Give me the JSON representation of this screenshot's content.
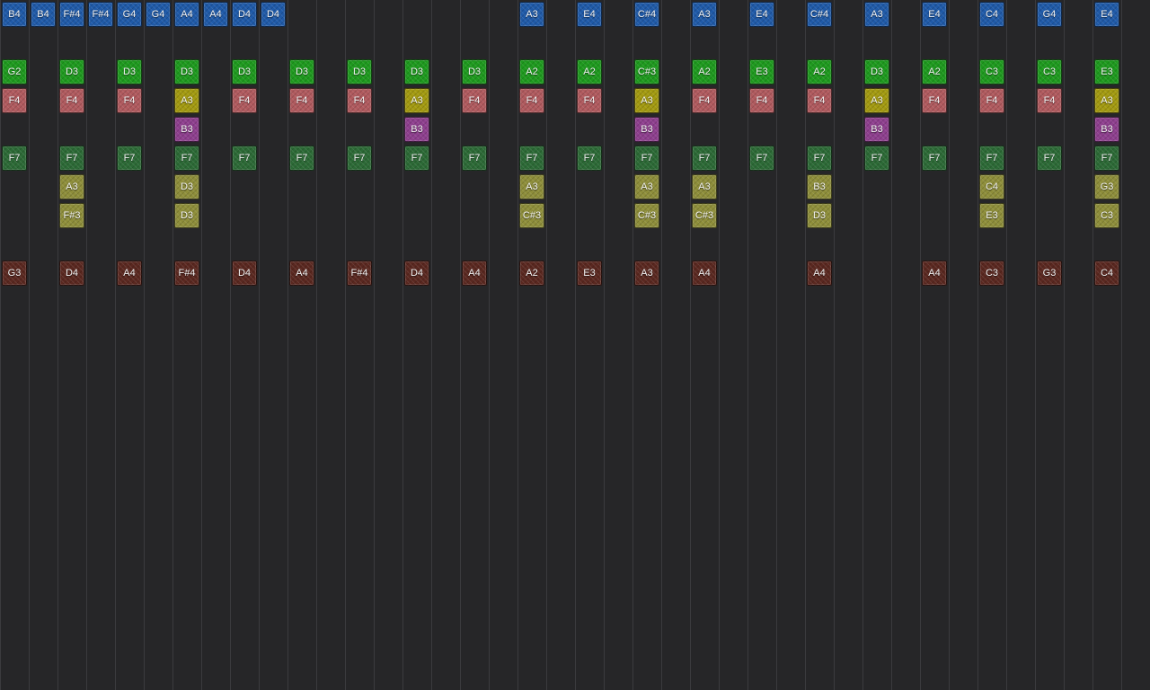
{
  "tracks": [
    {
      "name": "melody",
      "color": "#1f5aa8",
      "notes": [
        {
          "col": 0,
          "label": "B4"
        },
        {
          "col": 1,
          "label": "B4"
        },
        {
          "col": 2,
          "label": "F#4"
        },
        {
          "col": 3,
          "label": "F#4"
        },
        {
          "col": 4,
          "label": "G4"
        },
        {
          "col": 5,
          "label": "G4"
        },
        {
          "col": 6,
          "label": "A4"
        },
        {
          "col": 7,
          "label": "A4"
        },
        {
          "col": 8,
          "label": "D4"
        },
        {
          "col": 9,
          "label": "D4"
        },
        {
          "col": 18,
          "label": "A3"
        },
        {
          "col": 20,
          "label": "E4"
        },
        {
          "col": 22,
          "label": "C#4"
        },
        {
          "col": 24,
          "label": "A3"
        },
        {
          "col": 26,
          "label": "E4"
        },
        {
          "col": 28,
          "label": "C#4"
        },
        {
          "col": 30,
          "label": "A3"
        },
        {
          "col": 32,
          "label": "E4"
        },
        {
          "col": 34,
          "label": "C4"
        },
        {
          "col": 36,
          "label": "G4"
        },
        {
          "col": 38,
          "label": "E4"
        }
      ]
    },
    {
      "name": "bass-green",
      "color": "#1e9a1e",
      "notes": [
        {
          "col": 0,
          "label": "G2"
        },
        {
          "col": 2,
          "label": "D3"
        },
        {
          "col": 4,
          "label": "D3"
        },
        {
          "col": 6,
          "label": "D3"
        },
        {
          "col": 8,
          "label": "D3"
        },
        {
          "col": 10,
          "label": "D3"
        },
        {
          "col": 12,
          "label": "D3"
        },
        {
          "col": 14,
          "label": "D3"
        },
        {
          "col": 16,
          "label": "D3"
        },
        {
          "col": 18,
          "label": "A2"
        },
        {
          "col": 20,
          "label": "A2"
        },
        {
          "col": 22,
          "label": "C#3"
        },
        {
          "col": 24,
          "label": "A2"
        },
        {
          "col": 26,
          "label": "E3"
        },
        {
          "col": 28,
          "label": "A2"
        },
        {
          "col": 30,
          "label": "D3"
        },
        {
          "col": 32,
          "label": "A2"
        },
        {
          "col": 34,
          "label": "C3"
        },
        {
          "col": 36,
          "label": "C3"
        },
        {
          "col": 38,
          "label": "E3"
        }
      ]
    },
    {
      "name": "pink",
      "color": "#b05a5e",
      "notes": [
        {
          "col": 0,
          "label": "F4"
        },
        {
          "col": 2,
          "label": "F4"
        },
        {
          "col": 4,
          "label": "F4"
        },
        {
          "col": 8,
          "label": "F4"
        },
        {
          "col": 10,
          "label": "F4"
        },
        {
          "col": 12,
          "label": "F4"
        },
        {
          "col": 16,
          "label": "F4"
        },
        {
          "col": 18,
          "label": "F4"
        },
        {
          "col": 20,
          "label": "F4"
        },
        {
          "col": 24,
          "label": "F4"
        },
        {
          "col": 26,
          "label": "F4"
        },
        {
          "col": 28,
          "label": "F4"
        },
        {
          "col": 32,
          "label": "F4"
        },
        {
          "col": 34,
          "label": "F4"
        },
        {
          "col": 36,
          "label": "F4"
        }
      ]
    },
    {
      "name": "yellow",
      "color": "#a39a10",
      "notes": [
        {
          "col": 6,
          "label": "A3"
        },
        {
          "col": 14,
          "label": "A3"
        },
        {
          "col": 22,
          "label": "A3"
        },
        {
          "col": 30,
          "label": "A3"
        },
        {
          "col": 38,
          "label": "A3"
        }
      ]
    },
    {
      "name": "purple",
      "color": "#8e3f8e",
      "notes": [
        {
          "col": 6,
          "label": "B3"
        },
        {
          "col": 14,
          "label": "B3"
        },
        {
          "col": 22,
          "label": "B3"
        },
        {
          "col": 30,
          "label": "B3"
        },
        {
          "col": 38,
          "label": "B3"
        }
      ]
    },
    {
      "name": "dark-green",
      "color": "#2c6a36",
      "notes": [
        {
          "col": 0,
          "label": "F7"
        },
        {
          "col": 2,
          "label": "F7"
        },
        {
          "col": 4,
          "label": "F7"
        },
        {
          "col": 6,
          "label": "F7"
        },
        {
          "col": 8,
          "label": "F7"
        },
        {
          "col": 10,
          "label": "F7"
        },
        {
          "col": 12,
          "label": "F7"
        },
        {
          "col": 14,
          "label": "F7"
        },
        {
          "col": 16,
          "label": "F7"
        },
        {
          "col": 18,
          "label": "F7"
        },
        {
          "col": 20,
          "label": "F7"
        },
        {
          "col": 22,
          "label": "F7"
        },
        {
          "col": 24,
          "label": "F7"
        },
        {
          "col": 26,
          "label": "F7"
        },
        {
          "col": 28,
          "label": "F7"
        },
        {
          "col": 30,
          "label": "F7"
        },
        {
          "col": 32,
          "label": "F7"
        },
        {
          "col": 34,
          "label": "F7"
        },
        {
          "col": 36,
          "label": "F7"
        },
        {
          "col": 38,
          "label": "F7"
        }
      ]
    },
    {
      "name": "olive-1",
      "color": "#8e8e3a",
      "notes": [
        {
          "col": 2,
          "label": "A3"
        },
        {
          "col": 6,
          "label": "D3"
        },
        {
          "col": 18,
          "label": "A3"
        },
        {
          "col": 22,
          "label": "A3"
        },
        {
          "col": 24,
          "label": "A3"
        },
        {
          "col": 28,
          "label": "B3"
        },
        {
          "col": 34,
          "label": "C4"
        },
        {
          "col": 38,
          "label": "G3"
        }
      ]
    },
    {
      "name": "olive-2",
      "color": "#8e8e3a",
      "notes": [
        {
          "col": 2,
          "label": "F#3"
        },
        {
          "col": 6,
          "label": "D3"
        },
        {
          "col": 18,
          "label": "C#3"
        },
        {
          "col": 22,
          "label": "C#3"
        },
        {
          "col": 24,
          "label": "C#3"
        },
        {
          "col": 28,
          "label": "D3"
        },
        {
          "col": 34,
          "label": "E3"
        },
        {
          "col": 38,
          "label": "C3"
        }
      ]
    },
    {
      "name": "brown",
      "color": "#5a2820",
      "notes": [
        {
          "col": 0,
          "label": "G3"
        },
        {
          "col": 2,
          "label": "D4"
        },
        {
          "col": 4,
          "label": "A4"
        },
        {
          "col": 6,
          "label": "F#4"
        },
        {
          "col": 8,
          "label": "D4"
        },
        {
          "col": 10,
          "label": "A4"
        },
        {
          "col": 12,
          "label": "F#4"
        },
        {
          "col": 14,
          "label": "D4"
        },
        {
          "col": 16,
          "label": "A4"
        },
        {
          "col": 18,
          "label": "A2"
        },
        {
          "col": 20,
          "label": "E3"
        },
        {
          "col": 22,
          "label": "A3"
        },
        {
          "col": 24,
          "label": "A4"
        },
        {
          "col": 28,
          "label": "A4"
        },
        {
          "col": 32,
          "label": "A4"
        },
        {
          "col": 34,
          "label": "C3"
        },
        {
          "col": 36,
          "label": "G3"
        },
        {
          "col": 38,
          "label": "C4"
        }
      ]
    }
  ]
}
